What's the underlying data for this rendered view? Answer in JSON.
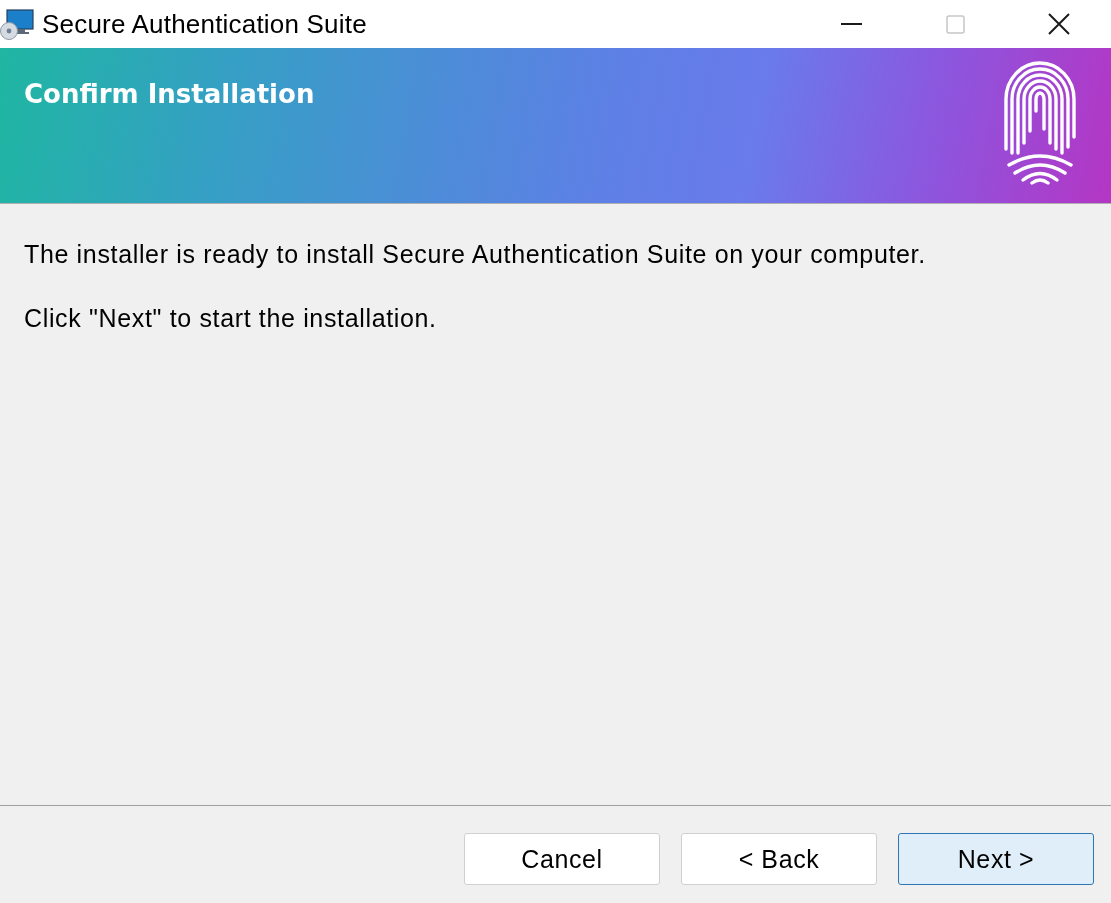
{
  "window": {
    "title": "Secure Authentication Suite",
    "controls": [
      {
        "kind": "minimize",
        "disabled": false
      },
      {
        "kind": "maximize",
        "disabled": true
      },
      {
        "kind": "close",
        "disabled": false
      }
    ]
  },
  "header": {
    "title": "Confirm Installation"
  },
  "body": {
    "paragraphs": [
      "The installer is ready to install Secure Authentication Suite on your computer.",
      "Click \"Next\" to start the installation."
    ]
  },
  "buttons": [
    {
      "label": "Cancel",
      "default": false
    },
    {
      "label": "< Back",
      "default": false
    },
    {
      "label": "Next >",
      "default": true
    }
  ]
}
